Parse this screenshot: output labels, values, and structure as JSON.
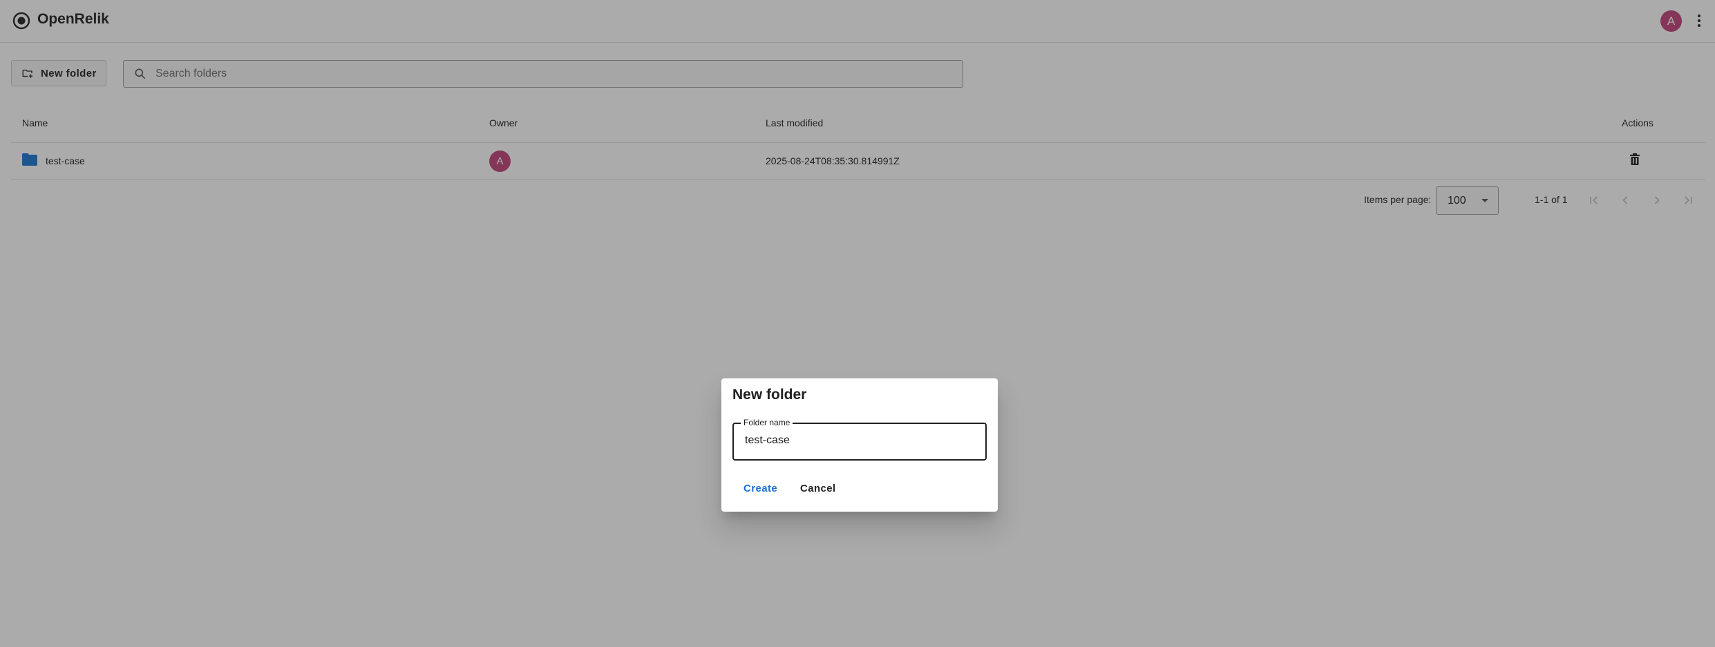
{
  "app": {
    "title": "OpenRelik",
    "user_initial": "A"
  },
  "toolbar": {
    "new_folder_label": "New folder",
    "search_placeholder": "Search folders"
  },
  "table": {
    "headers": {
      "name": "Name",
      "owner": "Owner",
      "last_modified": "Last modified",
      "actions": "Actions"
    },
    "rows": [
      {
        "name": "test-case",
        "owner_initial": "A",
        "last_modified": "2025-08-24T08:35:30.814991Z"
      }
    ]
  },
  "pagination": {
    "items_per_page_label": "Items per page:",
    "items_per_page_value": "100",
    "range": "1-1 of 1"
  },
  "dialog": {
    "title": "New folder",
    "field_label": "Folder name",
    "field_value": "test-case",
    "create_label": "Create",
    "cancel_label": "Cancel"
  },
  "colors": {
    "accent": "#1a6fd8",
    "avatar": "#c0427a",
    "folder": "#1976d2"
  }
}
